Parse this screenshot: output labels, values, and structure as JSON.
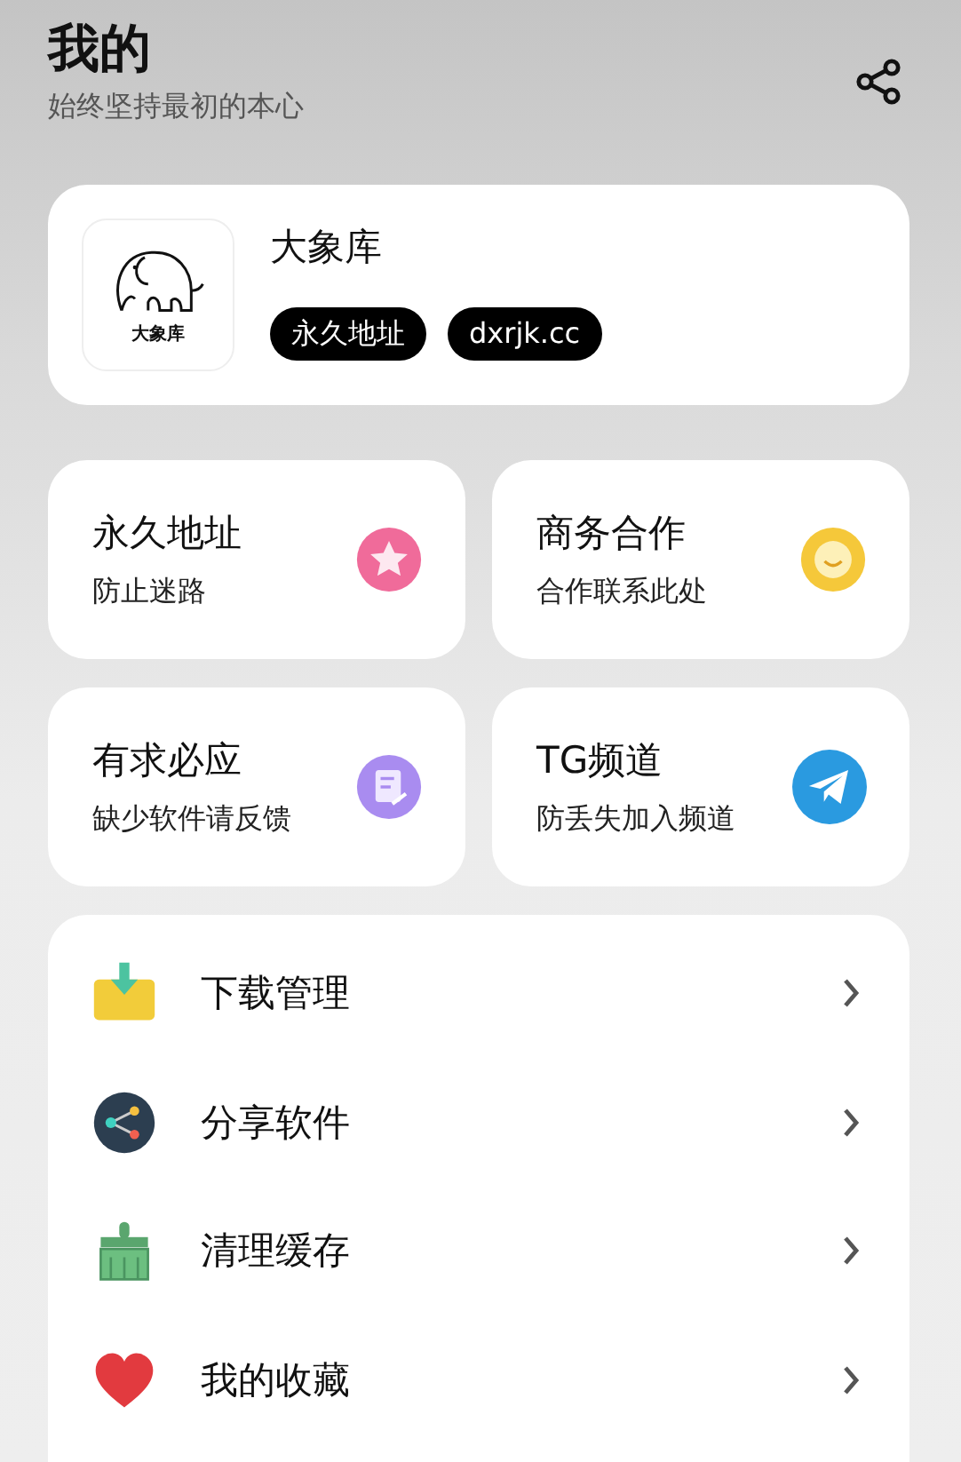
{
  "header": {
    "title": "我的",
    "subtitle": "始终坚持最初的本心"
  },
  "profile": {
    "logo_text": "大象库",
    "name": "大象库",
    "tags": [
      "永久地址",
      "dxrjk.cc"
    ]
  },
  "tiles": [
    {
      "title": "永久地址",
      "subtitle": "防止迷路",
      "kind": "star"
    },
    {
      "title": "商务合作",
      "subtitle": "合作联系此处",
      "kind": "smile"
    },
    {
      "title": "有求必应",
      "subtitle": "缺少软件请反馈",
      "kind": "note"
    },
    {
      "title": "TG频道",
      "subtitle": "防丢失加入频道",
      "kind": "plane"
    }
  ],
  "menu": [
    {
      "label": "下载管理",
      "kind": "download"
    },
    {
      "label": "分享软件",
      "kind": "share"
    },
    {
      "label": "清理缓存",
      "kind": "broom"
    },
    {
      "label": "我的收藏",
      "kind": "heart"
    }
  ]
}
